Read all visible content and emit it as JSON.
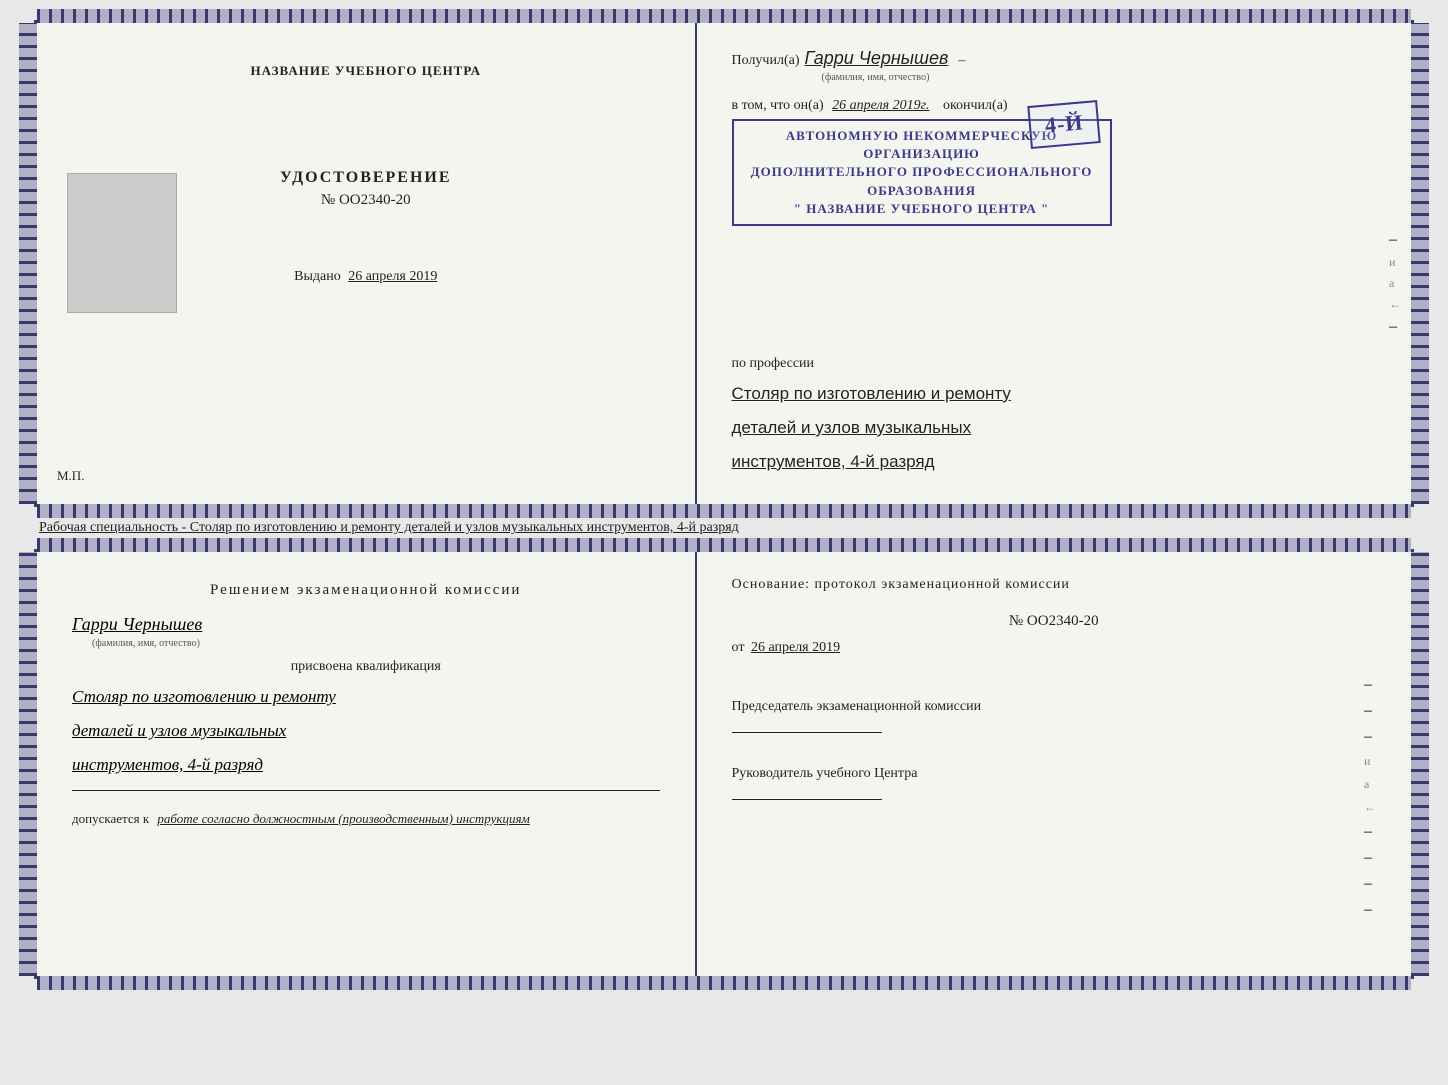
{
  "top_doc": {
    "left": {
      "org_name": "НАЗВАНИЕ УЧЕБНОГО ЦЕНТРА",
      "cert_title": "УДОСТОВЕРЕНИЕ",
      "cert_number": "№ OO2340-20",
      "issued_label": "Выдано",
      "issued_date": "26 апреля 2019",
      "mp_label": "М.П."
    },
    "right": {
      "received_label": "Получил(а)",
      "recipient_name": "Гарри Чернышев",
      "fio_label": "(фамилия, имя, отчество)",
      "dash": "–",
      "vtom_label": "в том, что он(а)",
      "date_label": "26 апреля 2019г.",
      "okonchil_label": "окончил(а)",
      "stamp_line1": "АВТОНОМНУЮ НЕКОММЕРЧЕСКУЮ ОРГАНИЗАЦИЮ",
      "stamp_line2": "ДОПОЛНИТЕЛЬНОГО ПРОФЕССИОНАЛЬНОГО ОБРАЗОВАНИЯ",
      "stamp_line3": "\" НАЗВАНИЕ УЧЕБНОГО ЦЕНТРА \"",
      "stamp_overlay": "4-й",
      "po_professii": "по профессии",
      "profession_line1": "Столяр по изготовлению и ремонту",
      "profession_line2": "деталей и узлов музыкальных",
      "profession_line3": "инструментов, 4-й разряд"
    }
  },
  "specialty_desc": "Рабочая специальность - Столяр по изготовлению и ремонту деталей и узлов музыкальных инструментов, 4-й разряд",
  "bottom_doc": {
    "left": {
      "decision_text": "Решением  экзаменационной  комиссии",
      "recipient_name": "Гарри Чернышев",
      "fio_label": "(фамилия, имя, отчество)",
      "prisvoena": "присвоена квалификация",
      "profession_line1": "Столяр по изготовлению и ремонту",
      "profession_line2": "деталей и узлов музыкальных",
      "profession_line3": "инструментов, 4-й разряд",
      "dopuskaetsya_label": "допускается к",
      "dopuskaetsya_value": "работе согласно должностным (производственным) инструкциям"
    },
    "right": {
      "osnovaniye": "Основание: протокол экзаменационной  комиссии",
      "protocol_number": "№  OO2340-20",
      "ot_label": "от",
      "date": "26 апреля 2019",
      "chairman_label": "Председатель экзаменационной комиссии",
      "rukovoditel_label": "Руководитель учебного Центра"
    }
  }
}
